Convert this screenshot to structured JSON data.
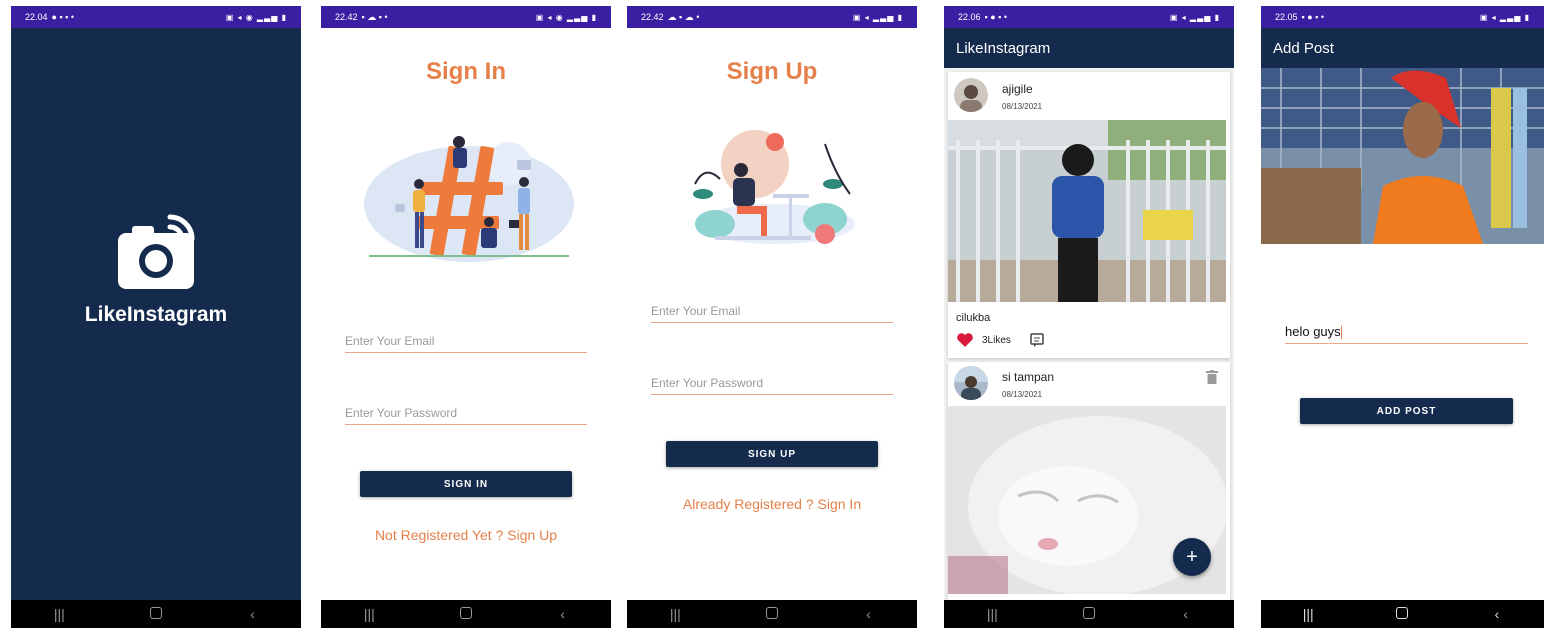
{
  "screens": {
    "splash": {
      "time": "22.04",
      "title": "LikeInstagram",
      "icon": "camera-icon"
    },
    "signin": {
      "time": "22.42",
      "title": "Sign In",
      "email_placeholder": "Enter Your Email",
      "password_placeholder": "Enter Your Password",
      "button": "SIGN IN",
      "link": "Not Registered Yet ? Sign Up"
    },
    "signup": {
      "time": "22.42",
      "title": "Sign Up",
      "email_placeholder": "Enter Your Email",
      "password_placeholder": "Enter Your Password",
      "button": "SIGN UP",
      "link": "Already Registered ? Sign In"
    },
    "feed": {
      "time": "22.06",
      "appbar_title": "LikeInstagram",
      "posts": [
        {
          "username": "ajigile",
          "date": "08/13/2021",
          "caption": "cilukba",
          "likes": "3Likes"
        },
        {
          "username": "si tampan",
          "date": "08/13/2021"
        }
      ],
      "fab": "+"
    },
    "addpost": {
      "time": "22.05",
      "appbar_title": "Add Post",
      "caption_value": "helo guys",
      "button": "ADD POST"
    }
  },
  "colors": {
    "navy": "#142b4d",
    "orange": "#e5804a",
    "statusbar": "#3b1fa3",
    "like_red": "#d81b3c"
  }
}
